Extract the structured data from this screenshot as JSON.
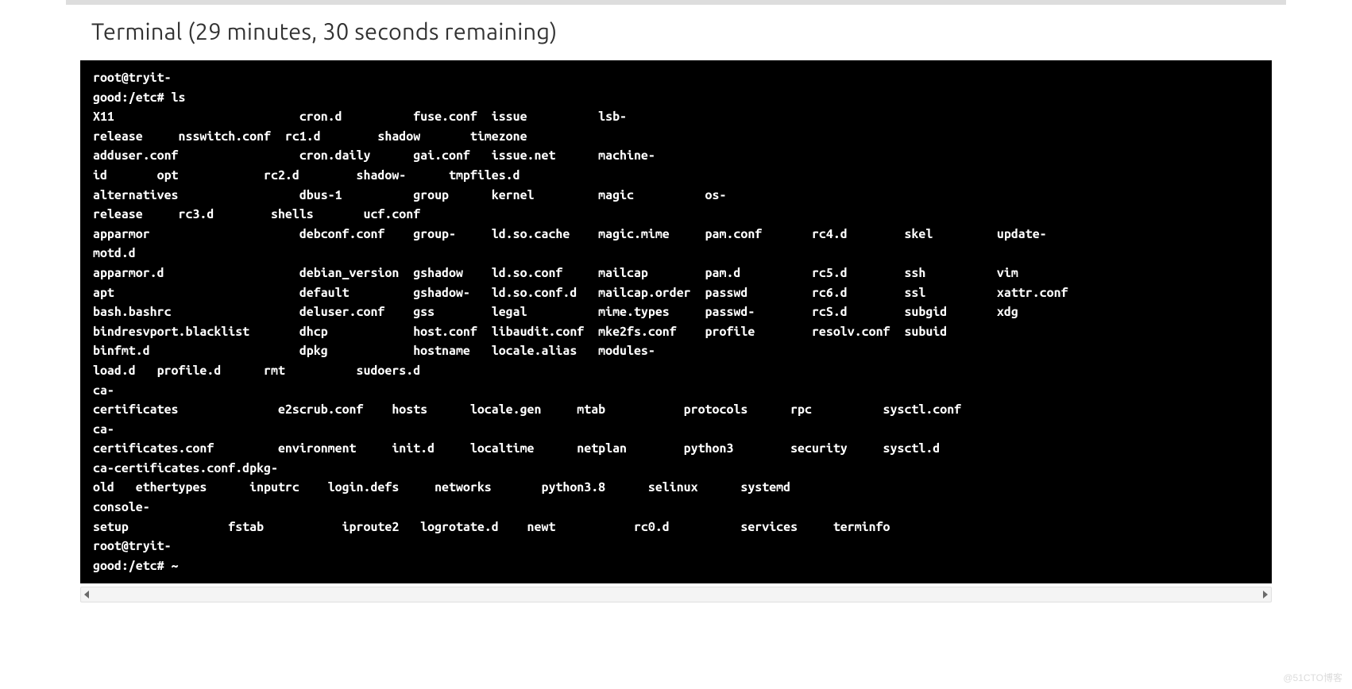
{
  "header": {
    "title": "Terminal (29 minutes, 30 seconds remaining)"
  },
  "terminal": {
    "prompt_user_host": "root@tryit-",
    "prompt_path_cmd": "good:/etc# ls",
    "prompt_end_user_host": "root@tryit-",
    "prompt_end_path": "good:/etc# ~",
    "lines": {
      "l01": "X11                          cron.d          fuse.conf  issue          lsb-",
      "l02": "release     nsswitch.conf  rc1.d        shadow       timezone",
      "l03": "adduser.conf                 cron.daily      gai.conf   issue.net      machine-",
      "l04": "id       opt            rc2.d        shadow-      tmpfiles.d",
      "l05": "alternatives                 dbus-1          group      kernel         magic          os-",
      "l06": "release     rc3.d        shells       ucf.conf",
      "l07": "apparmor                     debconf.conf    group-     ld.so.cache    magic.mime     pam.conf       rc4.d        skel         update-",
      "l08": "motd.d",
      "l09": "apparmor.d                   debian_version  gshadow    ld.so.conf     mailcap        pam.d          rc5.d        ssh          vim",
      "l10": "apt                          default         gshadow-   ld.so.conf.d   mailcap.order  passwd         rc6.d        ssl          xattr.conf",
      "l11": "bash.bashrc                  deluser.conf    gss        legal          mime.types     passwd-        rcS.d        subgid       xdg",
      "l12": "bindresvport.blacklist       dhcp            host.conf  libaudit.conf  mke2fs.conf    profile        resolv.conf  subuid",
      "l13": "binfmt.d                     dpkg            hostname   locale.alias   modules-",
      "l14": "load.d   profile.d      rmt          sudoers.d",
      "l15": "ca-",
      "l16": "certificates              e2scrub.conf    hosts      locale.gen     mtab           protocols      rpc          sysctl.conf",
      "l17": "ca-",
      "l18": "certificates.conf         environment     init.d     localtime      netplan        python3        security     sysctl.d",
      "l19": "ca-certificates.conf.dpkg-",
      "l20": "old   ethertypes      inputrc    login.defs     networks       python3.8      selinux      systemd",
      "l21": "console-",
      "l22": "setup              fstab           iproute2   logrotate.d    newt           rc0.d          services     terminfo"
    }
  },
  "watermark": "@51CTO博客"
}
